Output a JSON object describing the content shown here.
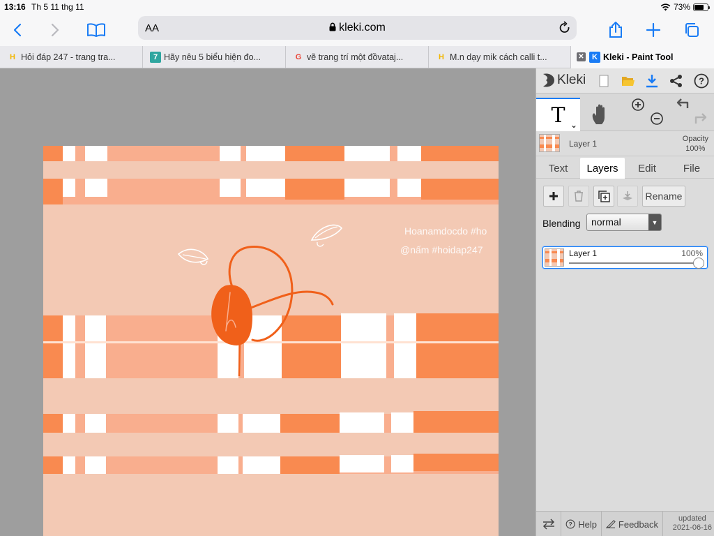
{
  "status": {
    "time": "13:16",
    "date": "Th 5 11 thg 11",
    "battery": "73%",
    "battery_level": 0.73
  },
  "browser": {
    "url": "kleki.com",
    "text_size_label": "AA"
  },
  "tabs": [
    {
      "label": "Hỏi đáp 247 - trang tra...",
      "icon": "H",
      "icon_color": "#f2b600"
    },
    {
      "label": "Hãy nêu 5 biểu hiện đo...",
      "icon": "7",
      "icon_color": "#2fa6a0"
    },
    {
      "label": "vẽ trang trí một đồvataj...",
      "icon": "G",
      "icon_color": "#ea4335"
    },
    {
      "label": "M.n dạy mik cách calli t...",
      "icon": "H",
      "icon_color": "#f2b600"
    },
    {
      "label": "Kleki - Paint Tool",
      "icon": "K",
      "icon_color": "#1a7cf5"
    }
  ],
  "canvas": {
    "signature_1": "Hoanamdocdo #ho",
    "signature_2": "@nấm #hoidap247",
    "colors": {
      "bg": "#f3c9b4",
      "light": "#f9ae8e",
      "dark": "#f98a50",
      "white": "#ffffff",
      "ink": "#f0601a"
    }
  },
  "panel": {
    "app_name": "Kleki",
    "layer_info_name": "Layer 1",
    "opacity_label": "Opacity",
    "opacity_value": "100%",
    "tabs": [
      "Text",
      "Layers",
      "Edit",
      "File"
    ],
    "active_tab": "Layers",
    "rename_label": "Rename",
    "blending_label": "Blending",
    "blending_value": "normal",
    "layer": {
      "name": "Layer 1",
      "opacity": "100%",
      "opacity_level": 1.0
    },
    "help_label": "Help",
    "feedback_label": "Feedback",
    "updated_label": "updated",
    "updated_date": "2021-06-16"
  }
}
